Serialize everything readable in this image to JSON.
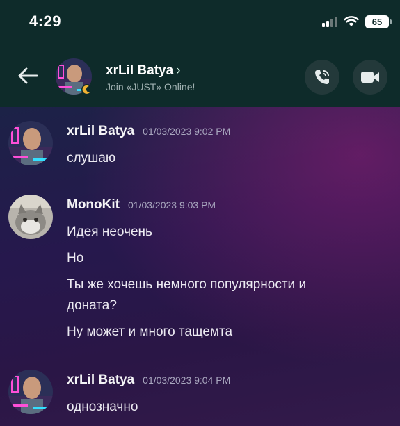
{
  "status_bar": {
    "time": "4:29",
    "battery": "65",
    "icons": [
      "cellular-signal-icon",
      "wifi-icon",
      "battery-icon"
    ]
  },
  "header": {
    "title": "xrLil Batya",
    "chevron": "›",
    "subtitle": "Join «JUST» Online!",
    "icons": [
      "back-arrow-icon",
      "phone-call-icon",
      "video-call-icon"
    ]
  },
  "messages": [
    {
      "author": "xrLil Batya",
      "timestamp": "01/03/2023 9:02 PM",
      "lines": [
        "слушаю"
      ]
    },
    {
      "author": "MonoKit",
      "timestamp": "01/03/2023 9:03 PM",
      "lines": [
        "Идея неочень",
        "Но",
        "Ты же хочешь немного популярности и",
        "доната?",
        "Ну может и много тащемта"
      ]
    },
    {
      "author": "xrLil Batya",
      "timestamp": "01/03/2023 9:04 PM",
      "lines": [
        "однозначно"
      ]
    }
  ],
  "colors": {
    "header_bg": "#0e2b2a",
    "chat_gradient_start": "#1c2247",
    "chat_gradient_end": "#331a4a",
    "accent_pink": "#ff4fd8",
    "accent_cyan": "#33e0ff"
  }
}
